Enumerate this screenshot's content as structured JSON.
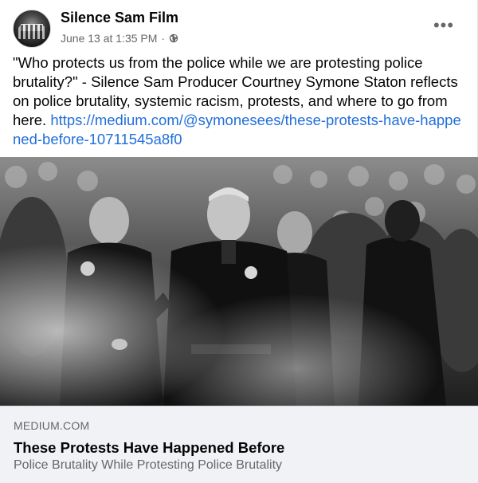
{
  "post": {
    "page_name": "Silence Sam Film",
    "timestamp": "June 13 at 1:35 PM",
    "separator": "·",
    "audience_icon": "globe-icon",
    "more_icon": "more-options-icon",
    "more_label": "•••",
    "text": "\"Who protects us from the police while we are protesting police brutality?\" - Silence Sam Producer Courtney Symone Staton reflects on police brutality, systemic racism, protests, and where to go from here.",
    "link_text": "https://medium.com/@symonesees/these-protests-have-happened-before-10711545a8f0"
  },
  "link_preview": {
    "domain": "MEDIUM.COM",
    "title": "These Protests Have Happened Before",
    "subtitle": "Police Brutality While Protesting Police Brutality"
  },
  "colors": {
    "link": "#216fdb",
    "secondary_text": "#65676b",
    "caption_bg": "#f0f2f5",
    "primary_text": "#050505"
  }
}
